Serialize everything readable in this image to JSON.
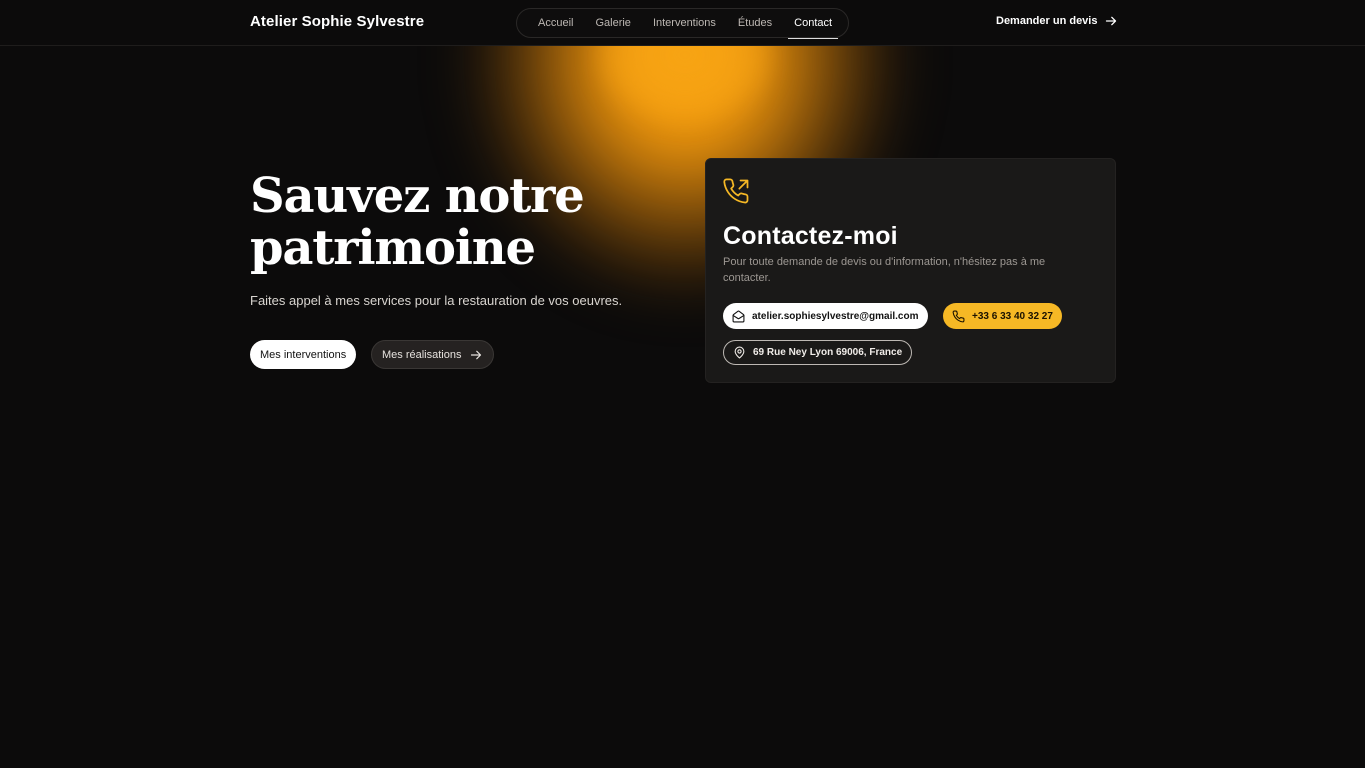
{
  "colors": {
    "background": "#0c0b0b",
    "accent": "#f6b825",
    "glow": "#f6a10f",
    "card": "#1a1918"
  },
  "header": {
    "brand": "Atelier Sophie Sylvestre",
    "nav": [
      {
        "label": "Accueil",
        "active": false
      },
      {
        "label": "Galerie",
        "active": false
      },
      {
        "label": "Interventions",
        "active": false
      },
      {
        "label": "Études",
        "active": false
      },
      {
        "label": "Contact",
        "active": true
      }
    ],
    "cta_label": "Demander un devis",
    "cta_icon": "arrow-right-icon"
  },
  "hero": {
    "title_line1": "Sauvez notre",
    "title_line2": "patrimoine",
    "subtitle": "Faites appel à mes services pour la restauration de vos oeuvres.",
    "primary_button": "Mes interventions",
    "secondary_button": "Mes réalisations",
    "secondary_icon": "arrow-right-icon"
  },
  "contact_card": {
    "icon": "phone-outgoing-icon",
    "title": "Contactez-moi",
    "description": "Pour toute demande de devis ou d'information, n'hésitez pas à me contacter.",
    "email": "atelier.sophiesylvestre@gmail.com",
    "email_icon": "mail-open-icon",
    "phone": "+33 6 33 40 32 27",
    "phone_icon": "phone-icon",
    "address": "69 Rue Ney Lyon 69006, France",
    "address_icon": "map-pin-icon"
  }
}
